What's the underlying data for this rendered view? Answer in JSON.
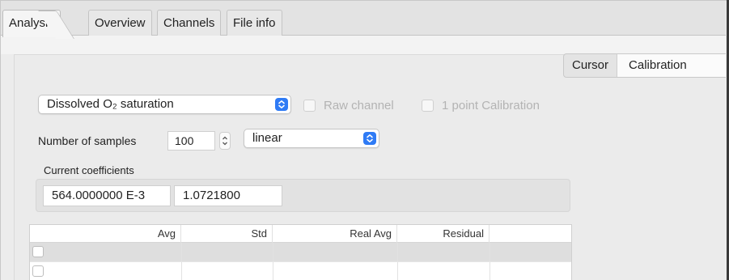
{
  "tabs": [
    {
      "label": "Analysis",
      "active": true
    },
    {
      "label": "Overview",
      "active": false
    },
    {
      "label": "Channels",
      "active": false
    },
    {
      "label": "File info",
      "active": false
    }
  ],
  "segmented": {
    "items": [
      "Cursor",
      "Calibration"
    ],
    "selected": "Calibration"
  },
  "channel_popup": {
    "value": "Dissolved O₂ saturation"
  },
  "raw_channel": {
    "label": "Raw channel",
    "checked": false,
    "enabled": false
  },
  "one_point_cal": {
    "label": "1 point Calibration",
    "checked": false,
    "enabled": false
  },
  "samples": {
    "label": "Number of samples",
    "value": "100"
  },
  "fit_popup": {
    "value": "linear"
  },
  "coefficients": {
    "label": "Current coefficients",
    "values": [
      "564.0000000 E-3",
      "1.0721800"
    ]
  },
  "table": {
    "columns": [
      "",
      "Avg",
      "Std",
      "Real Avg",
      "Residual",
      ""
    ],
    "rows": [
      {
        "checked": false,
        "avg": "",
        "std": "",
        "real_avg": "",
        "residual": ""
      },
      {
        "checked": false,
        "avg": "",
        "std": "",
        "real_avg": "",
        "residual": ""
      }
    ]
  },
  "colors": {
    "accent": "#2f7bf5",
    "window_bg": "#ececec",
    "selected_row": "#dedede"
  }
}
